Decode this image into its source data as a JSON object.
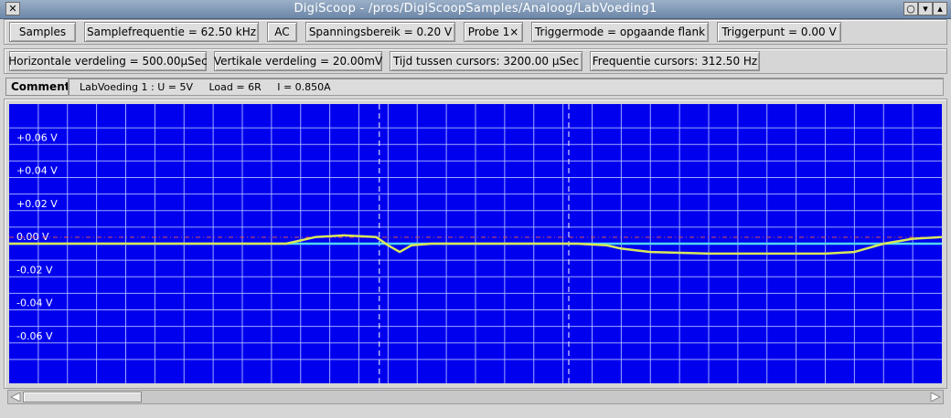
{
  "window": {
    "title": "DigiScoop - /pros/DigiScoopSamples/Analoog/LabVoeding1",
    "close_glyph": "✕",
    "btn_glyphs": [
      "○",
      "▾",
      "▴"
    ]
  },
  "toolbar1": {
    "samples": "Samples",
    "samplefrequentie": "Samplefrequentie = 62.50 kHz",
    "ac": "AC",
    "spanningsbereik": "Spanningsbereik = 0.20 V",
    "probe": "Probe 1×",
    "triggermode": "Triggermode = opgaande flank",
    "triggerpunt": "Triggerpunt = 0.00 V"
  },
  "toolbar2": {
    "horizontale": "Horizontale verdeling = 500.00µSec",
    "vertikale": "Vertikale verdeling = 20.00mV",
    "tijd": "Tijd tussen cursors: 3200.00 µSec",
    "frequentie": "Frequentie cursors: 312.50 Hz"
  },
  "comment": {
    "label": "Comment",
    "text": "LabVoeding 1 : U = 5V     Load = 6R     I = 0.850A"
  },
  "scope": {
    "y_labels": [
      "+0.06 V",
      "+0.04 V",
      "+0.02 V",
      "0.00 V",
      "-0.02 V",
      "-0.04 V",
      "-0.06 V"
    ],
    "colors": {
      "background": "#0000ee",
      "grid": "#b8c4ff",
      "trace": "#d8e85a",
      "baseline": "#50d8f0",
      "trigger_line": "#e05050",
      "cursor": "#ffffff"
    }
  },
  "chart_data": {
    "type": "line",
    "ylabel": "",
    "xlabel": "",
    "ylim": [
      -0.08,
      0.08
    ],
    "x_divisions": 32,
    "y_ticks": [
      0.06,
      0.04,
      0.02,
      0.0,
      -0.02,
      -0.04,
      -0.06
    ],
    "cursors_div": [
      12.7,
      19.2
    ],
    "series": [
      {
        "values_div_x": [
          0,
          9.5,
          10.5,
          11.5,
          12.6,
          13.0,
          13.4,
          13.8,
          14.5,
          18.0,
          19.5,
          20.5,
          21.0,
          22.0,
          24.0,
          26.0,
          28.0,
          29.0,
          30.0,
          31.0,
          32.0
        ],
        "values_v": [
          0.0,
          0.0,
          0.004,
          0.005,
          0.004,
          -0.001,
          -0.005,
          -0.001,
          0.0,
          0.0,
          0.0,
          -0.001,
          -0.003,
          -0.005,
          -0.006,
          -0.006,
          -0.006,
          -0.005,
          0.0,
          0.003,
          0.004
        ]
      }
    ]
  }
}
